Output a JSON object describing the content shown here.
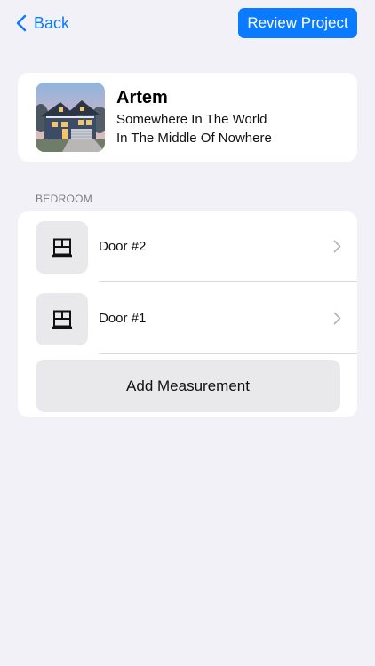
{
  "nav": {
    "back_label": "Back",
    "review_label": "Review Project"
  },
  "project": {
    "name": "Artem",
    "address_line1": "Somewhere In The World",
    "address_line2": "In The Middle Of Nowhere",
    "thumbnail_icon": "house-photo"
  },
  "section": {
    "title": "BEDROOM",
    "items": [
      {
        "label": "Door #2",
        "icon": "door-icon"
      },
      {
        "label": "Door #1",
        "icon": "door-icon"
      }
    ],
    "add_label": "Add Measurement"
  },
  "colors": {
    "accent": "#0a7aff",
    "background": "#f2f1f7",
    "card": "#ffffff",
    "tile": "#e9e9ec"
  }
}
